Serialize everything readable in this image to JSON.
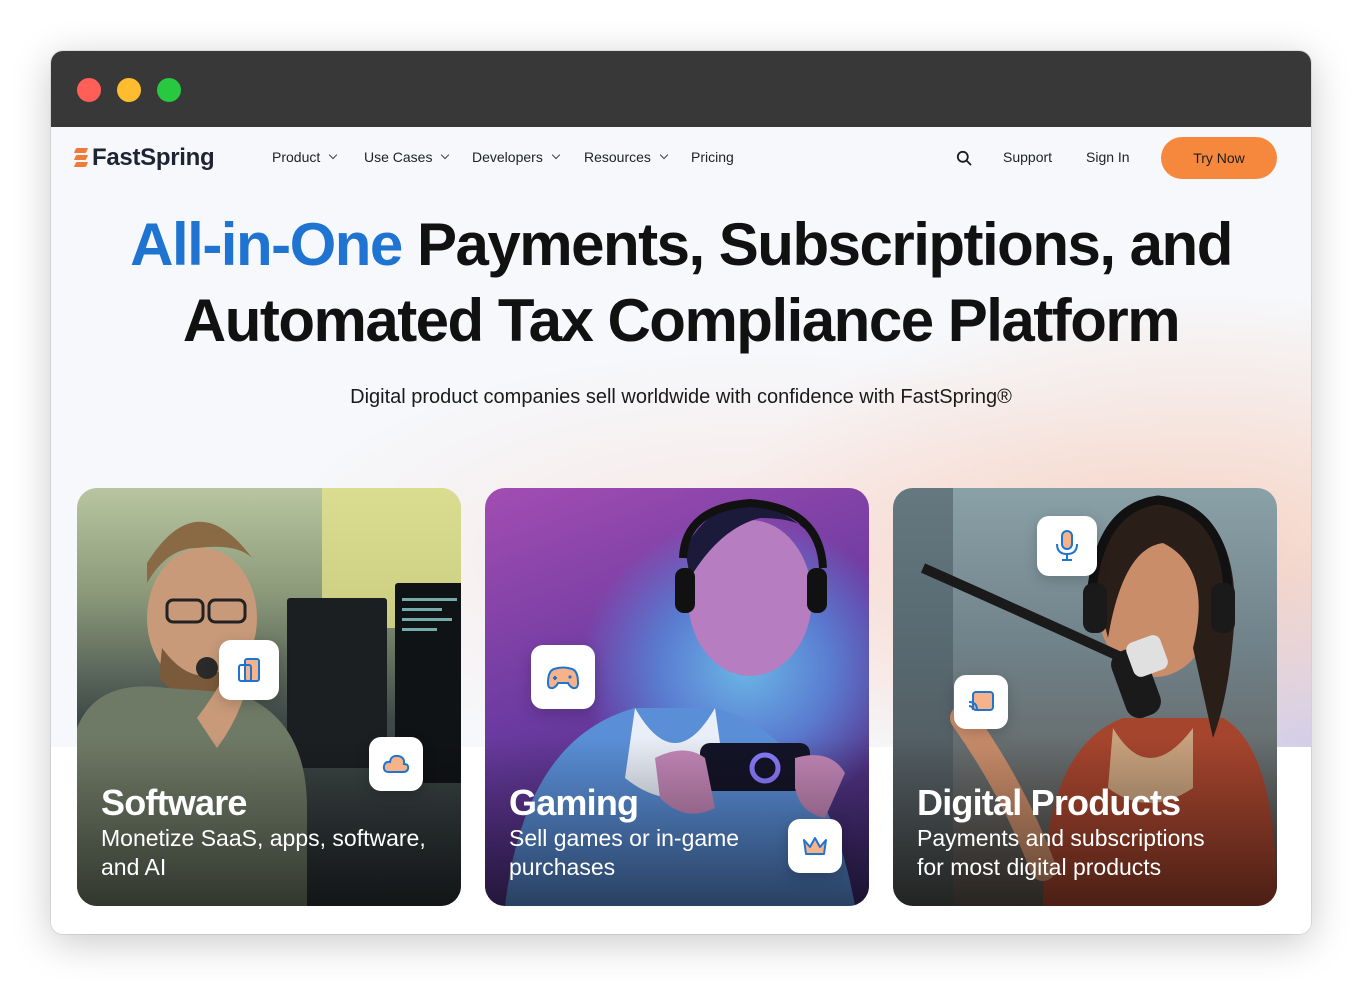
{
  "window": {
    "controls": [
      "close",
      "minimize",
      "maximize"
    ]
  },
  "nav": {
    "logo": "FastSpring",
    "items": [
      {
        "label": "Product",
        "dropdown": true
      },
      {
        "label": "Use Cases",
        "dropdown": true
      },
      {
        "label": "Developers",
        "dropdown": true
      },
      {
        "label": "Resources",
        "dropdown": true
      },
      {
        "label": "Pricing",
        "dropdown": false
      }
    ],
    "search_icon": "search-icon",
    "support": "Support",
    "sign_in": "Sign In",
    "cta": "Try Now"
  },
  "hero": {
    "title_accent": "All-in-One",
    "title_rest_line1": " Payments, Subscriptions, and",
    "title_line2": "Automated Tax Compliance Platform",
    "subtitle": "Digital product companies sell worldwide with confidence with FastSpring®"
  },
  "cards": [
    {
      "title": "Software",
      "description": "Monetize SaaS, apps, software, and AI",
      "icons": [
        "devices-icon",
        "cloud-icon"
      ]
    },
    {
      "title": "Gaming",
      "description": "Sell games or in-game purchases",
      "icons": [
        "gamepad-icon",
        "crown-icon"
      ]
    },
    {
      "title": "Digital Products",
      "description": "Payments and subscriptions for most digital products",
      "icons": [
        "microphone-icon",
        "cast-icon"
      ]
    }
  ],
  "colors": {
    "accent_blue": "#1f74d1",
    "cta_orange": "#f6883d",
    "titlebar": "#383838"
  }
}
